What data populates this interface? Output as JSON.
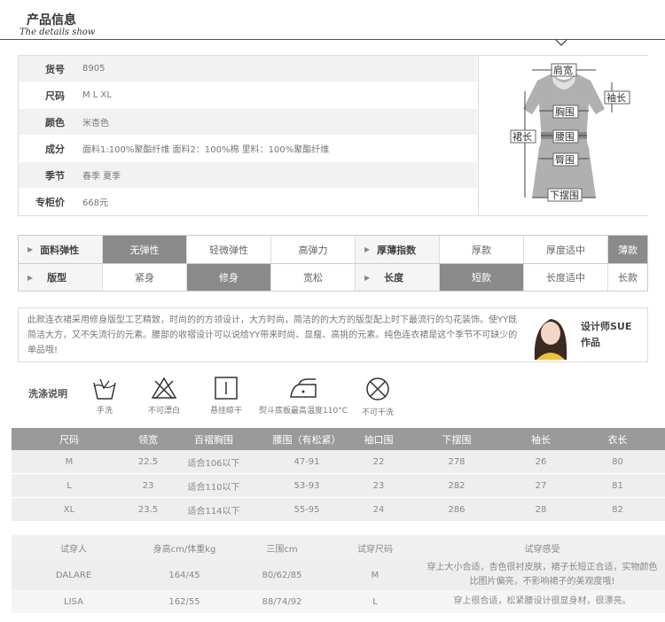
{
  "header": {
    "title": "产品信息",
    "subtitle": "The details show"
  },
  "info": {
    "rows": [
      {
        "key": "货号",
        "value": "8905"
      },
      {
        "key": "尺码",
        "value": "M L XL"
      },
      {
        "key": "颜色",
        "value": "米杏色"
      },
      {
        "key": "成分",
        "value": "面料1:100%聚酯纤维 面料2：100%棉 里料：100%聚酯纤维"
      },
      {
        "key": "季节",
        "value": "春季 夏季"
      },
      {
        "key": "专柜价",
        "value": "668元"
      }
    ],
    "diagram_labels": {
      "shoulder": "肩宽",
      "sleeve": "袖长",
      "chest": "胸围",
      "length": "裙长",
      "waist": "腰围",
      "hip": "臀围",
      "hem": "下摆围"
    }
  },
  "attributes": {
    "row1": {
      "fabric_label": "面料弹性",
      "fabric_options": [
        "无弹性",
        "轻微弹性",
        "高弹力"
      ],
      "thickness_label": "厚薄指数",
      "thickness_options": [
        "厚款",
        "厚度适中",
        "薄款"
      ]
    },
    "row2": {
      "fit_label": "版型",
      "fit_options": [
        "紧身",
        "修身",
        "宽松"
      ],
      "length_label": "长度",
      "length_options": [
        "短款",
        "长度适中",
        "长款"
      ]
    }
  },
  "description": {
    "text": "此款连衣裙采用修身版型工艺精致，时尚的的方领设计，大方时尚，简洁的的大方的版型配上时下最流行的匀花装饰。使YY既简洁大方，又不失流行的元素。腰部的收褶设计可以说给YY带来时尚、显瘦、高挑的元素。纯色连衣裙是这个季节不可缺少的单品哦!",
    "designer_line1": "设计师SUE",
    "designer_line2": "作品"
  },
  "care": {
    "label": "洗涤说明",
    "items": [
      {
        "icon": "hand-wash-icon",
        "label": "手洗"
      },
      {
        "icon": "no-bleach-icon",
        "label": "不可漂白"
      },
      {
        "icon": "hang-dry-icon",
        "label": "悬挂晾干"
      },
      {
        "icon": "iron-icon",
        "label": "熨斗底板最高温度110°C"
      },
      {
        "icon": "no-dry-clean-icon",
        "label": "不可干洗"
      }
    ]
  },
  "size_table": {
    "headers": [
      "尺码",
      "领宽",
      "百褶胸围",
      "腰围（有松紧）",
      "袖口围",
      "下摆围",
      "袖长",
      "衣长"
    ],
    "rows": [
      [
        "M",
        "22.5",
        "适合106以下",
        "47-91",
        "22",
        "278",
        "26",
        "80"
      ],
      [
        "L",
        "23",
        "适合110以下",
        "53-93",
        "23",
        "282",
        "27",
        "81"
      ],
      [
        "XL",
        "23.5",
        "适合114以下",
        "55-95",
        "24",
        "286",
        "28",
        "82"
      ]
    ]
  },
  "fit_table": {
    "headers": [
      "试穿人",
      "身高cm/体重kg",
      "三围cm",
      "试穿尺码",
      "试穿感受"
    ],
    "rows": [
      [
        "DALARE",
        "164/45",
        "80/62/85",
        "M",
        "穿上大小合适，杏色很衬皮肤，裙子长短正合适，实物颜色比图片偏亮，不影响裙子的美观度哦!"
      ],
      [
        "LISA",
        "162/55",
        "88/74/92",
        "L",
        "穿上很合适，松紧腰设计很显身材，很漂亮。"
      ]
    ]
  },
  "colors": {
    "selected": "#8a8a8a",
    "header_bg": "#9a9a9a",
    "row_alt": "#eeeeee"
  }
}
